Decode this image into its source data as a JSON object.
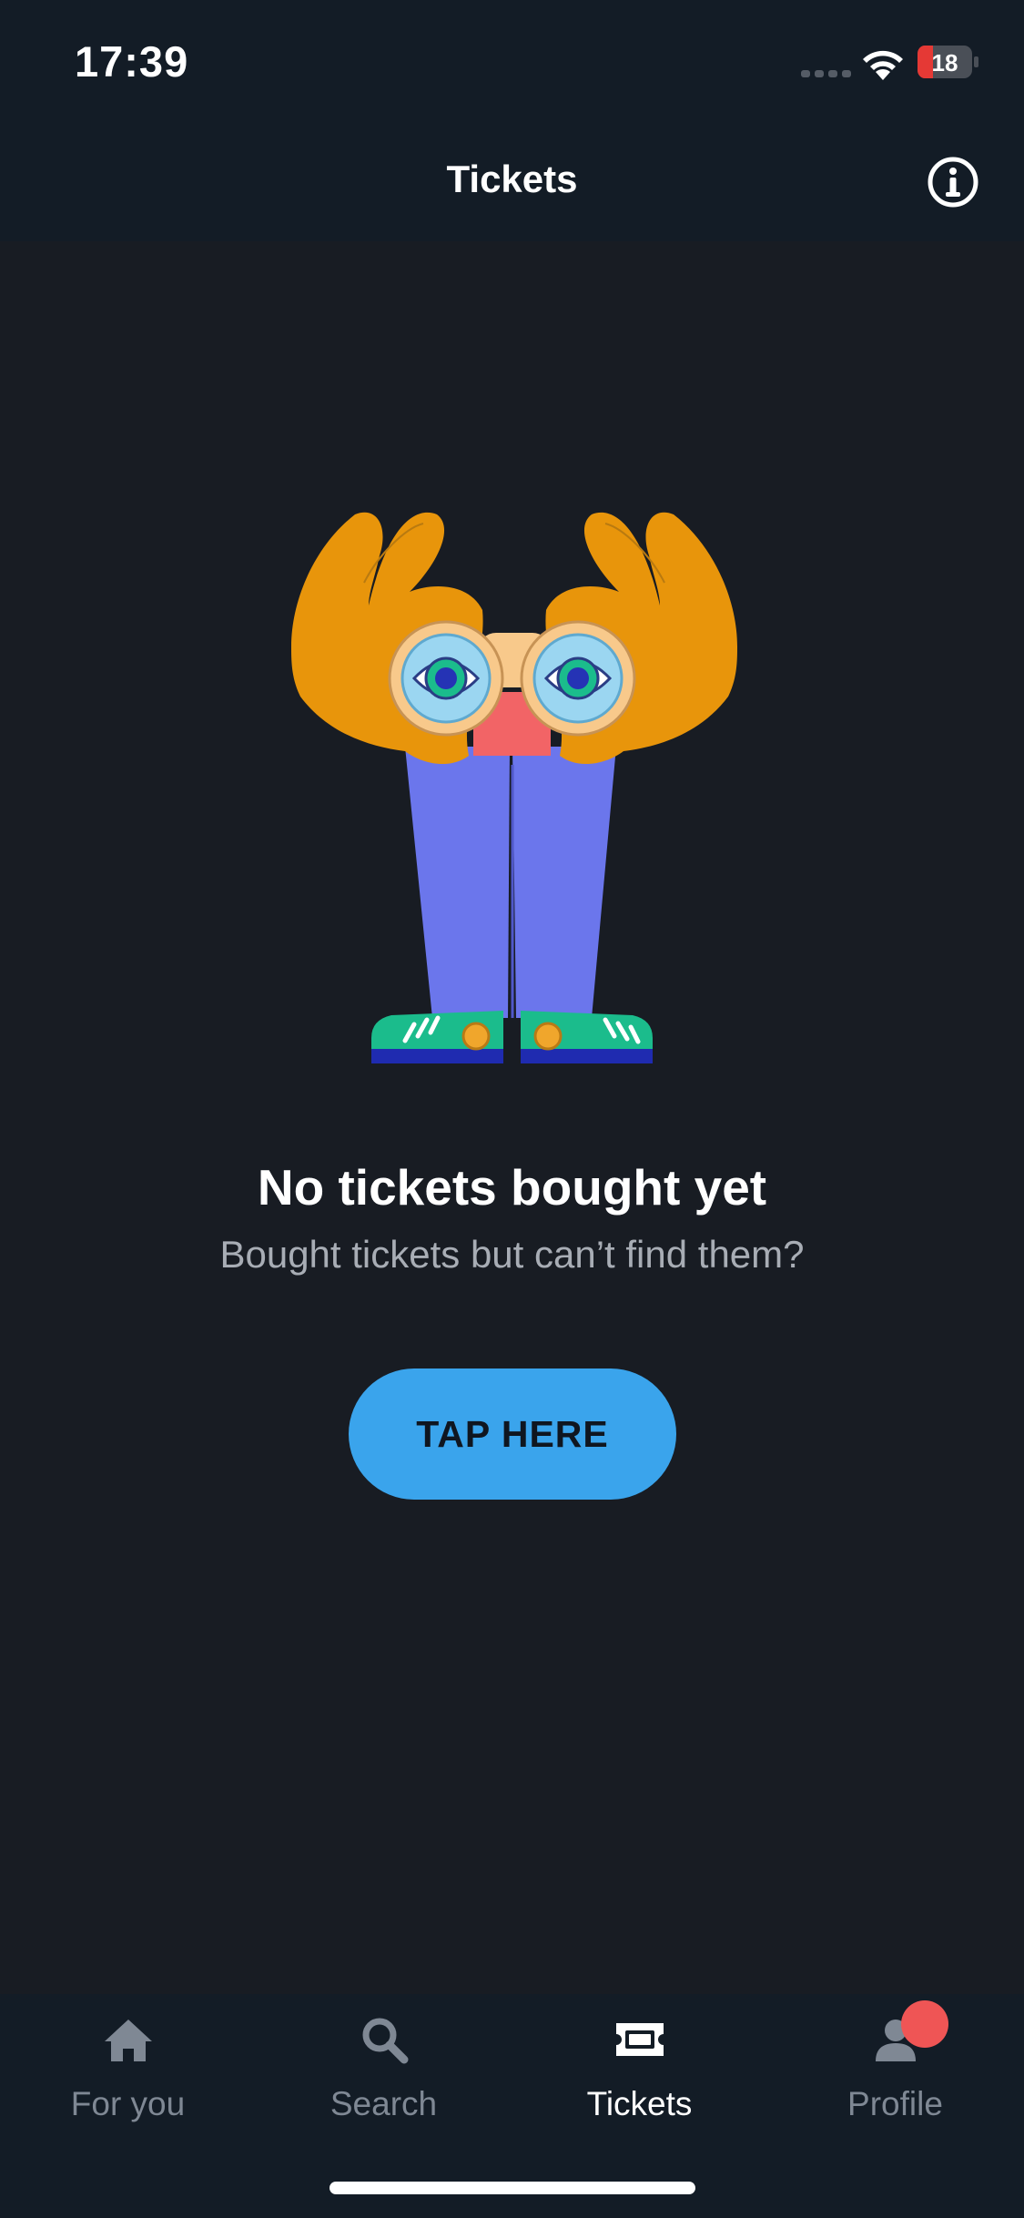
{
  "status_bar": {
    "time": "17:39",
    "battery_level": "18",
    "signal_icon": "cellular-signal-icon",
    "wifi_icon": "wifi-icon",
    "battery_color": "#e53935"
  },
  "header": {
    "title": "Tickets",
    "info_icon": "info-circle-icon"
  },
  "empty_state": {
    "illustration": "binocular-character-illustration",
    "title": "No tickets bought yet",
    "subtitle": "Bought tickets but can’t find them?",
    "button_label": "TAP HERE"
  },
  "tab_bar": {
    "items": [
      {
        "label": "For you",
        "icon": "home-icon",
        "active": false
      },
      {
        "label": "Search",
        "icon": "search-icon",
        "active": false
      },
      {
        "label": "Tickets",
        "icon": "ticket-icon",
        "active": true
      },
      {
        "label": "Profile",
        "icon": "profile-icon",
        "active": false,
        "badge": true
      }
    ]
  },
  "colors": {
    "background": "#181c23",
    "bars": "#131c26",
    "accent": "#3aa4ec",
    "badge": "#ef5555",
    "inactive_text": "#7f8894"
  }
}
